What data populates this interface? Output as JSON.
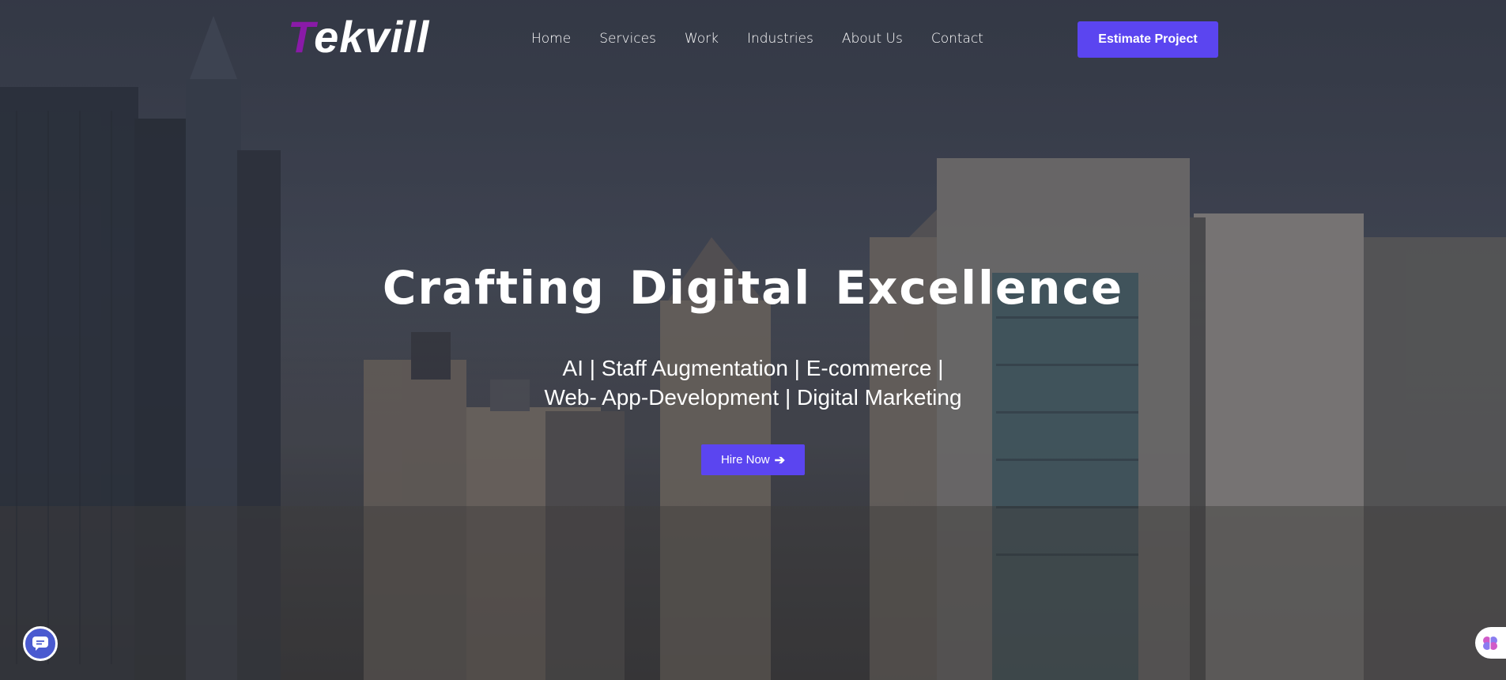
{
  "header": {
    "logo": {
      "first_letter": "T",
      "rest": "ekvill"
    },
    "nav": [
      "Home",
      "Services",
      "Work",
      "Industries",
      "About Us",
      "Contact"
    ],
    "cta_label": "Estimate Project"
  },
  "hero": {
    "title": "Crafting Digital Excellence",
    "subtitle_line1": "AI | Staff Augmentation | E-commerce |",
    "subtitle_line2": "Web- App-Development | Digital Marketing",
    "button_label": "Hire Now",
    "button_icon": "arrow-right-icon"
  },
  "widgets": {
    "chat_icon": "chat-bubble-icon",
    "side_icon": "brain-icon"
  },
  "colors": {
    "accent": "#5b45f0",
    "logo_accent": "#8a1aa8"
  }
}
